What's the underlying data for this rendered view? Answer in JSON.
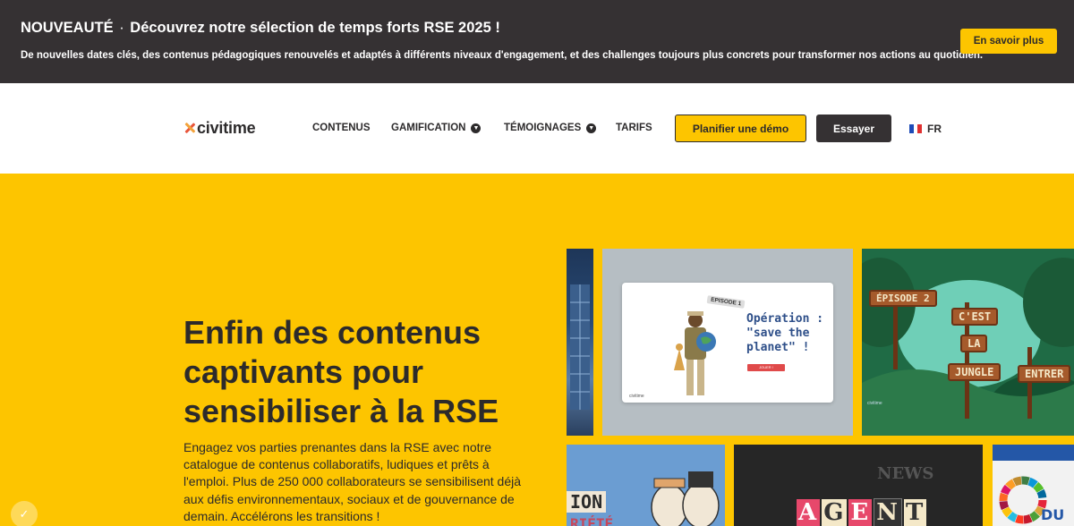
{
  "announcement": {
    "prefix": "NOUVEAUTÉ",
    "separator": "·",
    "title": "Découvrez notre sélection de temps forts RSE 2025 !",
    "description": "De nouvelles dates clés, des contenus pédagogiques renouvelés et adaptés à différents niveaux d'engagement, et des challenges toujours plus concrets pour transformer nos actions au quotidien.",
    "cta": "En savoir plus"
  },
  "nav": {
    "logo_text": "civitime",
    "items": [
      {
        "label": "CONTENUS",
        "dropdown": false
      },
      {
        "label": "GAMIFICATION",
        "dropdown": true
      },
      {
        "label": "TÉMOIGNAGES",
        "dropdown": true
      },
      {
        "label": "TARIFS",
        "dropdown": false
      }
    ],
    "demo_button": "Planifier une démo",
    "try_button": "Essayer",
    "language": "FR"
  },
  "hero": {
    "title_lines": [
      "Enfin des contenus",
      "captivants pour",
      "sensibiliser à la RSE"
    ],
    "text_lines": [
      "Engagez vos parties prenantes dans la RSE avec notre",
      "catalogue de contenus collaboratifs, ludiques et prêts à",
      "l'emploi. Plus de 250 000 collaborateurs se sensibilisent déjà",
      "aux défis environnementaux, sociaux et de gouvernance de",
      "demain. Accélérons les transitions !"
    ]
  },
  "tiles": {
    "planet": {
      "episode": "EPISODE 1",
      "title": "Opération :\n\"save the\nplanet\" !",
      "button": "JOUER !",
      "brand": "civitime"
    },
    "jungle": {
      "episode": "ÉPISODE 2",
      "signs": [
        "C'EST",
        "LA",
        "JUNGLE",
        "ENTRER"
      ],
      "brand": "civitime"
    },
    "agent": {
      "news": "NEWS",
      "letters": [
        "A",
        "G",
        "E",
        "N",
        "T"
      ]
    },
    "societe": {
      "line1": "ION",
      "line2": "RIÉTÉ"
    },
    "sdg": {
      "text": "DU D"
    }
  },
  "colors": {
    "brand_yellow": "#fdc500",
    "dark": "#353133",
    "logo_red": "#e8553a",
    "logo_orange": "#f3a33c"
  }
}
